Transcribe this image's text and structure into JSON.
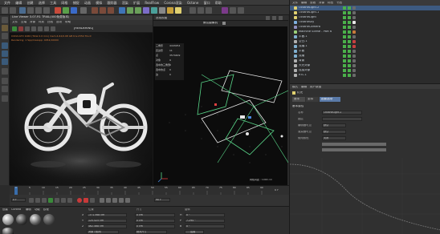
{
  "menubar": {
    "items": [
      "文件",
      "编辑",
      "创建",
      "选择",
      "工具",
      "网格",
      "捕捉",
      "动画",
      "模拟",
      "跟踪器",
      "渲染",
      "扩展",
      "RealFlow",
      "Corona渲染",
      "Octane",
      "窗口",
      "帮助"
    ]
  },
  "viewer": {
    "title": "Live Viewer 3.07-R1 TRIAL(400免费版本)",
    "menu": [
      "文件",
      "云端",
      "对象",
      "材质",
      "比较",
      "选项",
      "帮助"
    ],
    "status_tag": "[RENDERING]",
    "render_info": "CUDA:GTX 1060 (Total 0.0 min) mem:4.62/0.68 GB tris:2354 Tris:0",
    "render_info2": "Rendering: 1 Spp/maxspp: 4054/10000"
  },
  "viewport": {
    "title": "透视视图",
    "camera_label": "默认摄像机",
    "camera_icon": "camera-icon",
    "hud": {
      "rows": [
        {
          "label": "三角形",
          "value": "4443254"
        },
        {
          "label": "四边形",
          "value": "11"
        },
        {
          "label": "点",
          "value": "3574409"
        },
        {
          "label": "对象",
          "value": "9"
        },
        {
          "label": "选中的三角形",
          "value": "0"
        },
        {
          "label": "选中的点",
          "value": "0"
        },
        {
          "label": "边",
          "value": "0"
        }
      ]
    },
    "grid_spacing": "网格间距 : 1000 cm"
  },
  "object_manager": {
    "menu": [
      "文件",
      "编辑",
      "查看",
      "对象",
      "标签",
      "书签"
    ],
    "rows": [
      {
        "name": "OctaneLight.2",
        "color": "#e0d070",
        "selected": true
      },
      {
        "name": "OctaneLight.1",
        "color": "#e0d070",
        "selected": false
      },
      {
        "name": "OctaneLight",
        "color": "#e0d070",
        "selected": false
      },
      {
        "name": "OctaneSky",
        "color": "#7fb0e0",
        "selected": false
      },
      {
        "name": "OctaneCamera",
        "color": "#9090c0",
        "selected": false
      },
      {
        "name": "Machine Scene - Part 6",
        "color": "#9ad07a",
        "selected": false
      },
      {
        "name": "平面.1",
        "color": "#80b0d0",
        "selected": false
      },
      {
        "name": "空白.1",
        "color": "#b0b0b0",
        "selected": false
      },
      {
        "name": "克隆.1",
        "color": "#80b0d0",
        "selected": false
      },
      {
        "name": "平面",
        "color": "#80b0d0",
        "selected": false
      },
      {
        "name": "克隆",
        "color": "#80b0d0",
        "selected": false
      },
      {
        "name": "背景",
        "color": "#b0b0b0",
        "selected": false
      },
      {
        "name": "天光对象",
        "color": "#b0b0b0",
        "selected": false
      },
      {
        "name": "连接对象",
        "color": "#b0b0b0",
        "selected": false
      },
      {
        "name": "RTL.1",
        "color": "#b0b0b0",
        "selected": false
      }
    ]
  },
  "attributes": {
    "menu": [
      "模式",
      "编辑",
      "用户数据"
    ],
    "object_label": "灯光",
    "tabs": [
      "基本",
      "坐标",
      "投影选项"
    ],
    "section": "基本属性",
    "fields": [
      {
        "label": "名称",
        "value": "OctaneLight.2"
      },
      {
        "label": "图层",
        "value": ""
      },
      {
        "label": "编辑器可见",
        "value": "默认"
      },
      {
        "label": "渲染器可见",
        "value": "默认"
      },
      {
        "label": "使用颜色",
        "value": "关闭"
      }
    ]
  },
  "timeline": {
    "ticks": [
      "0",
      "5",
      "10",
      "15",
      "20",
      "25",
      "30",
      "35",
      "40",
      "45",
      "50",
      "55",
      "60",
      "65",
      "70",
      "75",
      "80",
      "85",
      "90"
    ],
    "frame_end": "0 F",
    "current_frame": "90 F",
    "start_frame": "0 F"
  },
  "materials": {
    "menu": [
      "创建",
      "Corona",
      "编辑",
      "功能",
      "纹理"
    ],
    "coords": {
      "position_header": "位置",
      "size_header": "尺寸",
      "rotation_header": "旋转",
      "rows": [
        {
          "axis": "X",
          "pos": "-371.568 cm",
          "size": "0 cm",
          "rot_axis": "H",
          "rot": "0 °"
        },
        {
          "axis": "Y",
          "pos": "125.425 cm",
          "size": "0 cm",
          "rot_axis": "P",
          "rot": "7.294 °"
        },
        {
          "axis": "Z",
          "pos": "462.468 cm",
          "size": "0 cm",
          "rot_axis": "B",
          "rot": "0 °"
        }
      ],
      "mode": "对象 (相对)",
      "size_mode": "绝对尺寸",
      "apply": "应用"
    }
  }
}
